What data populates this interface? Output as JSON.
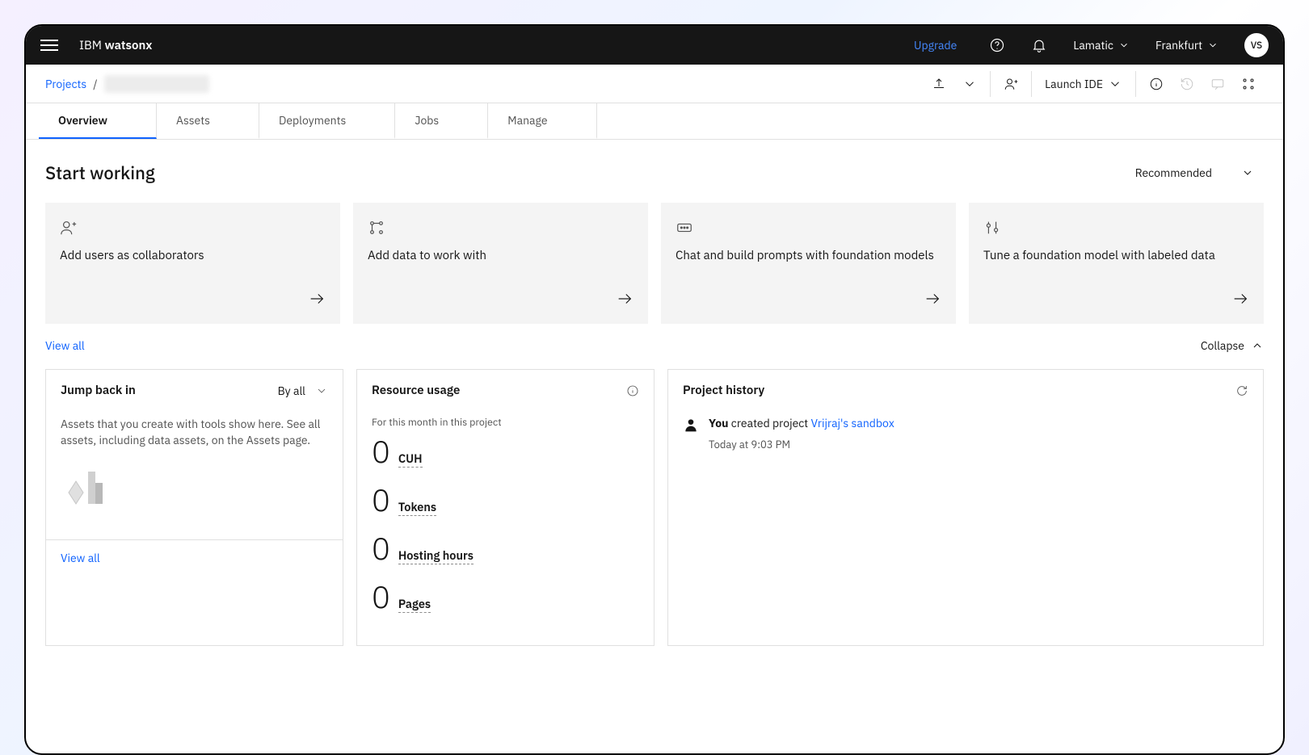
{
  "brand": {
    "prefix": "IBM ",
    "name": "watsonx"
  },
  "topbar": {
    "upgrade": "Upgrade",
    "org": "Lamatic",
    "region": "Frankfurt",
    "avatar": "VS"
  },
  "breadcrumb": {
    "root": "Projects"
  },
  "subbar": {
    "launch_ide": "Launch IDE"
  },
  "tabs": [
    {
      "label": "Overview",
      "active": true
    },
    {
      "label": "Assets"
    },
    {
      "label": "Deployments"
    },
    {
      "label": "Jobs"
    },
    {
      "label": "Manage"
    }
  ],
  "start_working": {
    "title": "Start working",
    "sort": "Recommended",
    "cards": [
      {
        "title": "Add users as collaborators"
      },
      {
        "title": "Add data to work with"
      },
      {
        "title": "Chat and build prompts with foundation models"
      },
      {
        "title": "Tune a foundation model with labeled data"
      }
    ],
    "view_all": "View all",
    "collapse": "Collapse"
  },
  "jump": {
    "title": "Jump back in",
    "filter": "By all",
    "description": "Assets that you create with tools show here. See all assets, including data assets, on the Assets page.",
    "view_all": "View all"
  },
  "usage": {
    "title": "Resource usage",
    "caption": "For this month in this project",
    "metrics": [
      {
        "value": "0",
        "label": "CUH"
      },
      {
        "value": "0",
        "label": "Tokens"
      },
      {
        "value": "0",
        "label": "Hosting hours"
      },
      {
        "value": "0",
        "label": "Pages"
      }
    ]
  },
  "history": {
    "title": "Project history",
    "item": {
      "actor": "You",
      "verb": " created project ",
      "target": "Vrijraj's sandbox",
      "time": "Today at 9:03 PM"
    }
  }
}
